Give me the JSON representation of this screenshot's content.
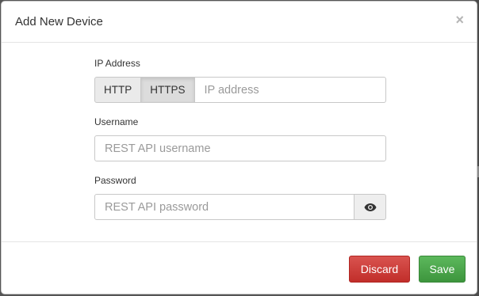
{
  "modal": {
    "title": "Add New Device",
    "close_glyph": "×"
  },
  "form": {
    "ip": {
      "label": "IP Address",
      "protocols": [
        "HTTP",
        "HTTPS"
      ],
      "selected_protocol": "HTTPS",
      "placeholder": "IP address",
      "value": ""
    },
    "username": {
      "label": "Username",
      "placeholder": "REST API username",
      "value": ""
    },
    "password": {
      "label": "Password",
      "placeholder": "REST API password",
      "value": "",
      "toggle_icon": "eye-icon"
    }
  },
  "footer": {
    "discard_label": "Discard",
    "save_label": "Save"
  },
  "colors": {
    "discard": "#d9534f",
    "save": "#5cb85c"
  }
}
